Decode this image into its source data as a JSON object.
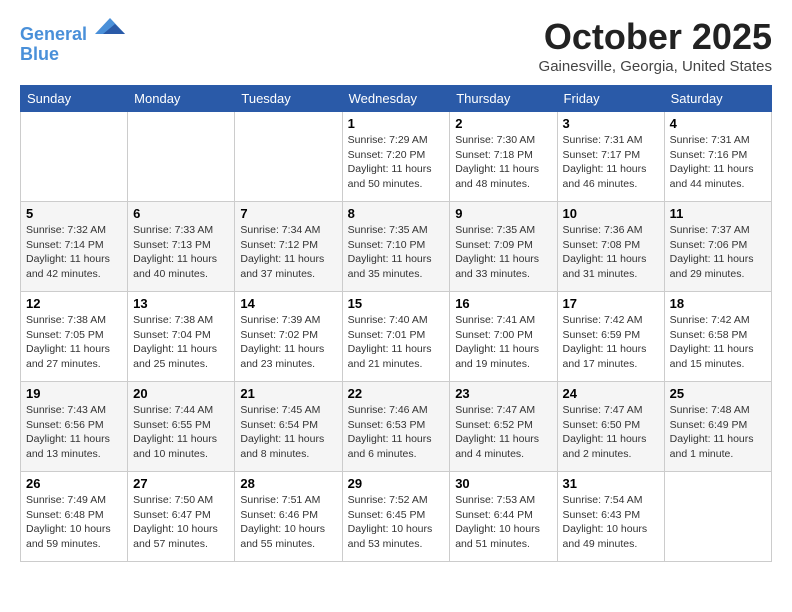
{
  "logo": {
    "line1": "General",
    "line2": "Blue"
  },
  "title": "October 2025",
  "location": "Gainesville, Georgia, United States",
  "days_of_week": [
    "Sunday",
    "Monday",
    "Tuesday",
    "Wednesday",
    "Thursday",
    "Friday",
    "Saturday"
  ],
  "weeks": [
    [
      {
        "day": "",
        "sunrise": "",
        "sunset": "",
        "daylight": ""
      },
      {
        "day": "",
        "sunrise": "",
        "sunset": "",
        "daylight": ""
      },
      {
        "day": "",
        "sunrise": "",
        "sunset": "",
        "daylight": ""
      },
      {
        "day": "1",
        "sunrise": "Sunrise: 7:29 AM",
        "sunset": "Sunset: 7:20 PM",
        "daylight": "Daylight: 11 hours and 50 minutes."
      },
      {
        "day": "2",
        "sunrise": "Sunrise: 7:30 AM",
        "sunset": "Sunset: 7:18 PM",
        "daylight": "Daylight: 11 hours and 48 minutes."
      },
      {
        "day": "3",
        "sunrise": "Sunrise: 7:31 AM",
        "sunset": "Sunset: 7:17 PM",
        "daylight": "Daylight: 11 hours and 46 minutes."
      },
      {
        "day": "4",
        "sunrise": "Sunrise: 7:31 AM",
        "sunset": "Sunset: 7:16 PM",
        "daylight": "Daylight: 11 hours and 44 minutes."
      }
    ],
    [
      {
        "day": "5",
        "sunrise": "Sunrise: 7:32 AM",
        "sunset": "Sunset: 7:14 PM",
        "daylight": "Daylight: 11 hours and 42 minutes."
      },
      {
        "day": "6",
        "sunrise": "Sunrise: 7:33 AM",
        "sunset": "Sunset: 7:13 PM",
        "daylight": "Daylight: 11 hours and 40 minutes."
      },
      {
        "day": "7",
        "sunrise": "Sunrise: 7:34 AM",
        "sunset": "Sunset: 7:12 PM",
        "daylight": "Daylight: 11 hours and 37 minutes."
      },
      {
        "day": "8",
        "sunrise": "Sunrise: 7:35 AM",
        "sunset": "Sunset: 7:10 PM",
        "daylight": "Daylight: 11 hours and 35 minutes."
      },
      {
        "day": "9",
        "sunrise": "Sunrise: 7:35 AM",
        "sunset": "Sunset: 7:09 PM",
        "daylight": "Daylight: 11 hours and 33 minutes."
      },
      {
        "day": "10",
        "sunrise": "Sunrise: 7:36 AM",
        "sunset": "Sunset: 7:08 PM",
        "daylight": "Daylight: 11 hours and 31 minutes."
      },
      {
        "day": "11",
        "sunrise": "Sunrise: 7:37 AM",
        "sunset": "Sunset: 7:06 PM",
        "daylight": "Daylight: 11 hours and 29 minutes."
      }
    ],
    [
      {
        "day": "12",
        "sunrise": "Sunrise: 7:38 AM",
        "sunset": "Sunset: 7:05 PM",
        "daylight": "Daylight: 11 hours and 27 minutes."
      },
      {
        "day": "13",
        "sunrise": "Sunrise: 7:38 AM",
        "sunset": "Sunset: 7:04 PM",
        "daylight": "Daylight: 11 hours and 25 minutes."
      },
      {
        "day": "14",
        "sunrise": "Sunrise: 7:39 AM",
        "sunset": "Sunset: 7:02 PM",
        "daylight": "Daylight: 11 hours and 23 minutes."
      },
      {
        "day": "15",
        "sunrise": "Sunrise: 7:40 AM",
        "sunset": "Sunset: 7:01 PM",
        "daylight": "Daylight: 11 hours and 21 minutes."
      },
      {
        "day": "16",
        "sunrise": "Sunrise: 7:41 AM",
        "sunset": "Sunset: 7:00 PM",
        "daylight": "Daylight: 11 hours and 19 minutes."
      },
      {
        "day": "17",
        "sunrise": "Sunrise: 7:42 AM",
        "sunset": "Sunset: 6:59 PM",
        "daylight": "Daylight: 11 hours and 17 minutes."
      },
      {
        "day": "18",
        "sunrise": "Sunrise: 7:42 AM",
        "sunset": "Sunset: 6:58 PM",
        "daylight": "Daylight: 11 hours and 15 minutes."
      }
    ],
    [
      {
        "day": "19",
        "sunrise": "Sunrise: 7:43 AM",
        "sunset": "Sunset: 6:56 PM",
        "daylight": "Daylight: 11 hours and 13 minutes."
      },
      {
        "day": "20",
        "sunrise": "Sunrise: 7:44 AM",
        "sunset": "Sunset: 6:55 PM",
        "daylight": "Daylight: 11 hours and 10 minutes."
      },
      {
        "day": "21",
        "sunrise": "Sunrise: 7:45 AM",
        "sunset": "Sunset: 6:54 PM",
        "daylight": "Daylight: 11 hours and 8 minutes."
      },
      {
        "day": "22",
        "sunrise": "Sunrise: 7:46 AM",
        "sunset": "Sunset: 6:53 PM",
        "daylight": "Daylight: 11 hours and 6 minutes."
      },
      {
        "day": "23",
        "sunrise": "Sunrise: 7:47 AM",
        "sunset": "Sunset: 6:52 PM",
        "daylight": "Daylight: 11 hours and 4 minutes."
      },
      {
        "day": "24",
        "sunrise": "Sunrise: 7:47 AM",
        "sunset": "Sunset: 6:50 PM",
        "daylight": "Daylight: 11 hours and 2 minutes."
      },
      {
        "day": "25",
        "sunrise": "Sunrise: 7:48 AM",
        "sunset": "Sunset: 6:49 PM",
        "daylight": "Daylight: 11 hours and 1 minute."
      }
    ],
    [
      {
        "day": "26",
        "sunrise": "Sunrise: 7:49 AM",
        "sunset": "Sunset: 6:48 PM",
        "daylight": "Daylight: 10 hours and 59 minutes."
      },
      {
        "day": "27",
        "sunrise": "Sunrise: 7:50 AM",
        "sunset": "Sunset: 6:47 PM",
        "daylight": "Daylight: 10 hours and 57 minutes."
      },
      {
        "day": "28",
        "sunrise": "Sunrise: 7:51 AM",
        "sunset": "Sunset: 6:46 PM",
        "daylight": "Daylight: 10 hours and 55 minutes."
      },
      {
        "day": "29",
        "sunrise": "Sunrise: 7:52 AM",
        "sunset": "Sunset: 6:45 PM",
        "daylight": "Daylight: 10 hours and 53 minutes."
      },
      {
        "day": "30",
        "sunrise": "Sunrise: 7:53 AM",
        "sunset": "Sunset: 6:44 PM",
        "daylight": "Daylight: 10 hours and 51 minutes."
      },
      {
        "day": "31",
        "sunrise": "Sunrise: 7:54 AM",
        "sunset": "Sunset: 6:43 PM",
        "daylight": "Daylight: 10 hours and 49 minutes."
      },
      {
        "day": "",
        "sunrise": "",
        "sunset": "",
        "daylight": ""
      }
    ]
  ]
}
